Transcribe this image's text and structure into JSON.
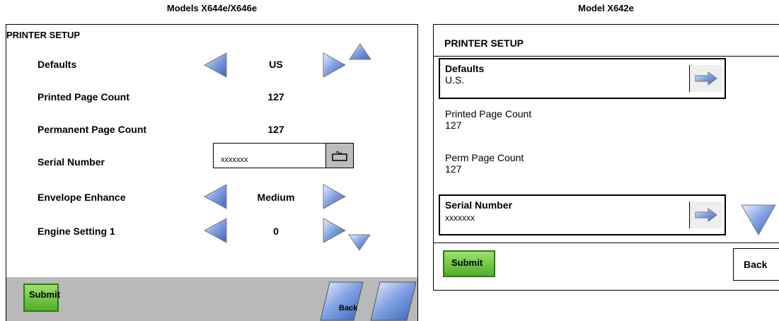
{
  "captions": {
    "left": "Models X644e/X646e",
    "right": "Model X642e"
  },
  "left": {
    "title": "PRINTER SETUP",
    "rows": [
      {
        "label": "Defaults",
        "value": "US"
      },
      {
        "label": "Printed Page Count",
        "value": "127"
      },
      {
        "label": "Permanent Page Count",
        "value": "127"
      },
      {
        "label": "Serial Number",
        "value": "xxxxxxx"
      },
      {
        "label": "Envelope Enhance",
        "value": "Medium"
      },
      {
        "label": "Engine Setting 1",
        "value": "0"
      }
    ],
    "submit": "Submit",
    "back": "Back"
  },
  "right": {
    "title": "PRINTER SETUP",
    "defaults": {
      "label": "Defaults",
      "value": "U.S."
    },
    "printed": {
      "label": "Printed Page Count",
      "value": "127"
    },
    "perm": {
      "label": "Perm Page Count",
      "value": "127"
    },
    "serial": {
      "label": "Serial Number",
      "value": "xxxxxxx"
    },
    "submit": "Submit",
    "back": "Back"
  },
  "colors": {
    "arrow_blue": "#6f93d9",
    "submit_green": "#5cb832",
    "footer_gray": "#b9b9b9"
  },
  "icons": [
    "arrow-left-icon",
    "arrow-right-icon",
    "scroll-up-icon",
    "scroll-down-icon",
    "keyboard-icon",
    "forward-arrow-icon"
  ]
}
